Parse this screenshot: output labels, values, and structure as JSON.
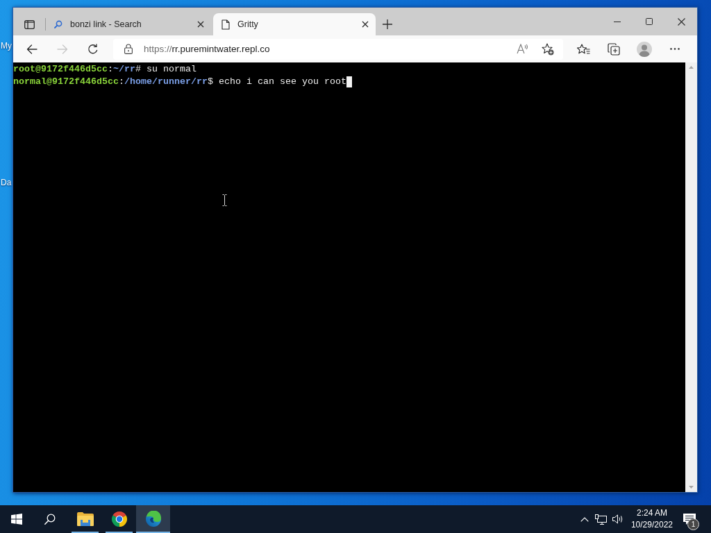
{
  "desktop": {
    "icons": [
      {
        "label": "My"
      },
      {
        "label": "Da"
      }
    ]
  },
  "browser": {
    "tabs": [
      {
        "kind": "search",
        "title": "bonzi link - Search",
        "selected": false
      },
      {
        "kind": "page",
        "title": "Gritty",
        "selected": true
      }
    ],
    "nav_buttons": [
      {
        "kind": "back",
        "disabled": false
      },
      {
        "kind": "forward",
        "disabled": true
      },
      {
        "kind": "refresh",
        "disabled": false
      }
    ],
    "address_bar": {
      "scheme": "https://",
      "host": "rr.puremintwater.repl.co"
    }
  },
  "terminal": {
    "lines": [
      {
        "user_host": "root@9172f446d5cc",
        "separator": ":",
        "path": "~/rr",
        "prompt": "#",
        "command": "su normal",
        "cursor": false
      },
      {
        "user_host": "normal@9172f446d5cc",
        "separator": ":",
        "path": "/home/runner/rr",
        "prompt": "$",
        "command": "echo i can see you root",
        "cursor": true
      }
    ]
  },
  "taskbar": {
    "apps": [
      {
        "kind": "file-explorer",
        "running": true,
        "selected": false
      },
      {
        "kind": "chrome",
        "running": true,
        "selected": false
      },
      {
        "kind": "edge",
        "running": true,
        "selected": true
      }
    ],
    "clock": {
      "time": "2:24 AM",
      "date": "10/29/2022"
    },
    "notifications": {
      "count": "1"
    }
  }
}
